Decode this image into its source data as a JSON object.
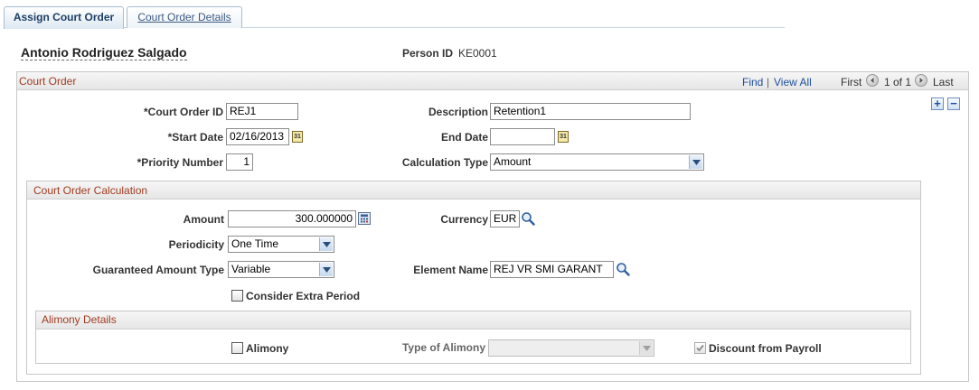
{
  "tabs": [
    {
      "label": "Assign Court Order",
      "active": true
    },
    {
      "label": "Court Order Details",
      "active": false
    }
  ],
  "header": {
    "person_name": "Antonio Rodriguez Salgado",
    "person_id_label": "Person ID",
    "person_id": "KE0001"
  },
  "court_order": {
    "title": "Court Order",
    "nav": {
      "find": "Find",
      "separator": "|",
      "view_all": "View All",
      "first": "First",
      "range": "1 of 1",
      "last": "Last"
    },
    "fields": {
      "court_order_id_label": "*Court Order ID",
      "court_order_id": "REJ1",
      "description_label": "Description",
      "description": "Retention1",
      "start_date_label": "*Start Date",
      "start_date": "02/16/2013",
      "end_date_label": "End Date",
      "end_date": "",
      "priority_label": "*Priority Number",
      "priority": "1",
      "calc_type_label": "Calculation Type",
      "calc_type": "Amount"
    }
  },
  "calculation": {
    "title": "Court Order Calculation",
    "amount_label": "Amount",
    "amount": "300.000000",
    "currency_label": "Currency",
    "currency": "EUR",
    "periodicity_label": "Periodicity",
    "periodicity": "One Time",
    "guaranteed_label": "Guaranteed Amount Type",
    "guaranteed": "Variable",
    "element_label": "Element Name",
    "element": "REJ VR SMI GARANT",
    "extra_period_label": "Consider Extra Period",
    "extra_period_checked": false
  },
  "alimony": {
    "title": "Alimony Details",
    "alimony_label": "Alimony",
    "alimony_checked": false,
    "type_label": "Type of Alimony",
    "type_value": "",
    "discount_label": "Discount from Payroll",
    "discount_checked": true
  },
  "icons": {
    "calendar": "calendar-icon",
    "lookup": "magnifier-icon",
    "calculator": "calculator-icon",
    "first": "first-arrow-icon",
    "last": "last-arrow-icon",
    "add": "plus-icon",
    "remove": "minus-icon"
  },
  "colors": {
    "section_title": "#a03c22",
    "link": "#1d4f9c",
    "tab_active_text": "#1d3f66"
  }
}
